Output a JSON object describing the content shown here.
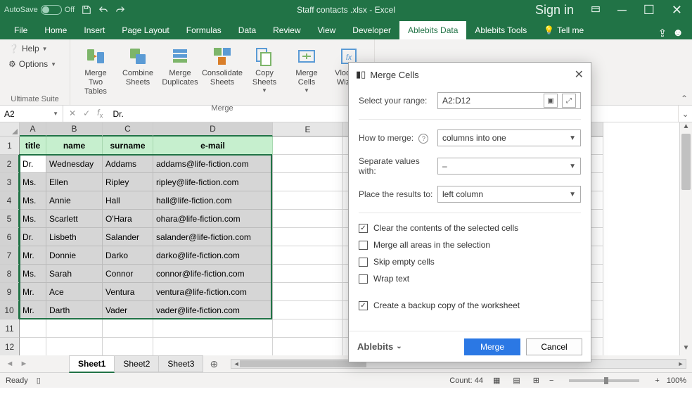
{
  "titlebar": {
    "autosave_label": "AutoSave",
    "autosave_state": "Off",
    "title": "Staff contacts .xlsx - Excel",
    "signin": "Sign in"
  },
  "tabs": [
    "File",
    "Home",
    "Insert",
    "Page Layout",
    "Formulas",
    "Data",
    "Review",
    "View",
    "Developer",
    "Ablebits Data",
    "Ablebits Tools"
  ],
  "active_tab": "Ablebits Data",
  "tellme": "Tell me",
  "ribbon": {
    "help": "Help",
    "options": "Options",
    "suite_label": "Ultimate Suite",
    "merge_group_label": "Merge",
    "merge_two_tables": "Merge\nTwo Tables",
    "combine_sheets": "Combine\nSheets",
    "merge_duplicates": "Merge\nDuplicates",
    "consolidate_sheets": "Consolidate\nSheets",
    "copy_sheets": "Copy\nSheets",
    "merge_cells": "Merge\nCells",
    "vlookup_wizard": "Vlookup\nWizard"
  },
  "formula_bar": {
    "name_box": "A2",
    "formula": "Dr."
  },
  "columns": [
    {
      "id": "A",
      "w": 38
    },
    {
      "id": "B",
      "w": 80
    },
    {
      "id": "C",
      "w": 72
    },
    {
      "id": "D",
      "w": 170
    },
    {
      "id": "E",
      "w": 100
    },
    {
      "id": "F",
      "w": 100
    },
    {
      "id": "G",
      "w": 100
    },
    {
      "id": "H",
      "w": 170
    }
  ],
  "selected_cols": [
    "A",
    "B",
    "C",
    "D"
  ],
  "headers": [
    "title",
    "name",
    "surname",
    "e-mail"
  ],
  "rows": [
    {
      "n": 2,
      "v": [
        "Dr.",
        "Wednesday",
        "Addams",
        "addams@life-fiction.com"
      ]
    },
    {
      "n": 3,
      "v": [
        "Ms.",
        "Ellen",
        "Ripley",
        "ripley@life-fiction.com"
      ]
    },
    {
      "n": 4,
      "v": [
        "Ms.",
        "Annie",
        "Hall",
        "hall@life-fiction.com"
      ]
    },
    {
      "n": 5,
      "v": [
        "Ms.",
        "Scarlett",
        "O'Hara",
        "ohara@life-fiction.com"
      ]
    },
    {
      "n": 6,
      "v": [
        "Dr.",
        "Lisbeth",
        "Salander",
        "salander@life-fiction.com"
      ]
    },
    {
      "n": 7,
      "v": [
        "Mr.",
        "Donnie",
        "Darko",
        "darko@life-fiction.com"
      ]
    },
    {
      "n": 8,
      "v": [
        "Ms.",
        "Sarah",
        "Connor",
        "connor@life-fiction.com"
      ]
    },
    {
      "n": 9,
      "v": [
        "Mr.",
        "Ace",
        "Ventura",
        "ventura@life-fiction.com"
      ]
    },
    {
      "n": 10,
      "v": [
        "Mr.",
        "Darth",
        "Vader",
        "vader@life-fiction.com"
      ]
    }
  ],
  "sheet_tabs": [
    "Sheet1",
    "Sheet2",
    "Sheet3"
  ],
  "active_sheet": "Sheet1",
  "statusbar": {
    "ready": "Ready",
    "count": "Count: 44",
    "zoom": "100%"
  },
  "dialog": {
    "title": "Merge Cells",
    "range_label": "Select your range:",
    "range_value": "A2:D12",
    "how_label": "How to merge:",
    "how_value": "columns into one",
    "sep_label": "Separate values with:",
    "sep_value": "–",
    "place_label": "Place the results to:",
    "place_value": "left column",
    "chk_clear": "Clear the contents of the selected cells",
    "chk_merge_areas": "Merge all areas in the selection",
    "chk_skip": "Skip empty cells",
    "chk_wrap": "Wrap text",
    "chk_backup": "Create a backup copy of the worksheet",
    "brand": "Ablebits",
    "merge_btn": "Merge",
    "cancel_btn": "Cancel"
  }
}
